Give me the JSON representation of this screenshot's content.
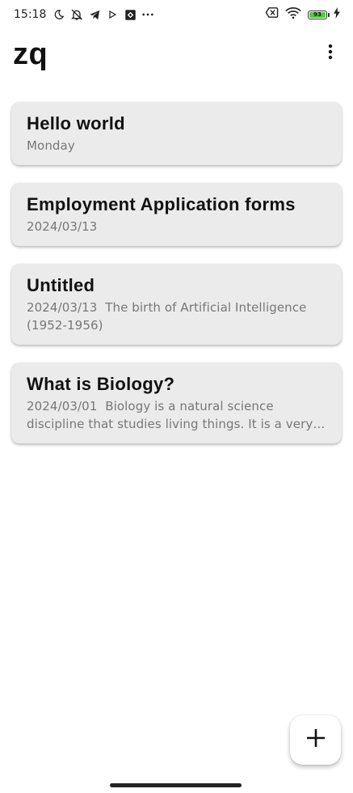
{
  "status_bar": {
    "time": "15:18",
    "left_icons": [
      "moon-icon",
      "bell-off-icon",
      "telegram-icon",
      "play-icon",
      "app-badge-icon",
      "more-dots-icon"
    ],
    "right_icons": [
      "sim-off-icon",
      "wifi-icon",
      "battery-icon",
      "charging-icon"
    ],
    "battery_level": "93",
    "battery_color": "#4cd137"
  },
  "app_bar": {
    "title": "zq",
    "menu_icon": "more-vert-icon"
  },
  "notes": [
    {
      "title": "Hello world",
      "date": "Monday",
      "preview": ""
    },
    {
      "title": "Employment Application forms",
      "date": "2024/03/13",
      "preview": ""
    },
    {
      "title": "Untitled",
      "date": "2024/03/13",
      "preview": "The birth of Artificial Intelligence (1952-1956)"
    },
    {
      "title": "What is Biology?",
      "date": "2024/03/01",
      "preview": "Biology is a natural science discipline that studies living things. It is a very large and broad field due to the wide variety of life found on Earth"
    }
  ],
  "fab": {
    "icon": "plus-icon"
  },
  "colors": {
    "card_background": "#ebebeb",
    "meta_text": "#777777",
    "title_text": "#111111"
  }
}
